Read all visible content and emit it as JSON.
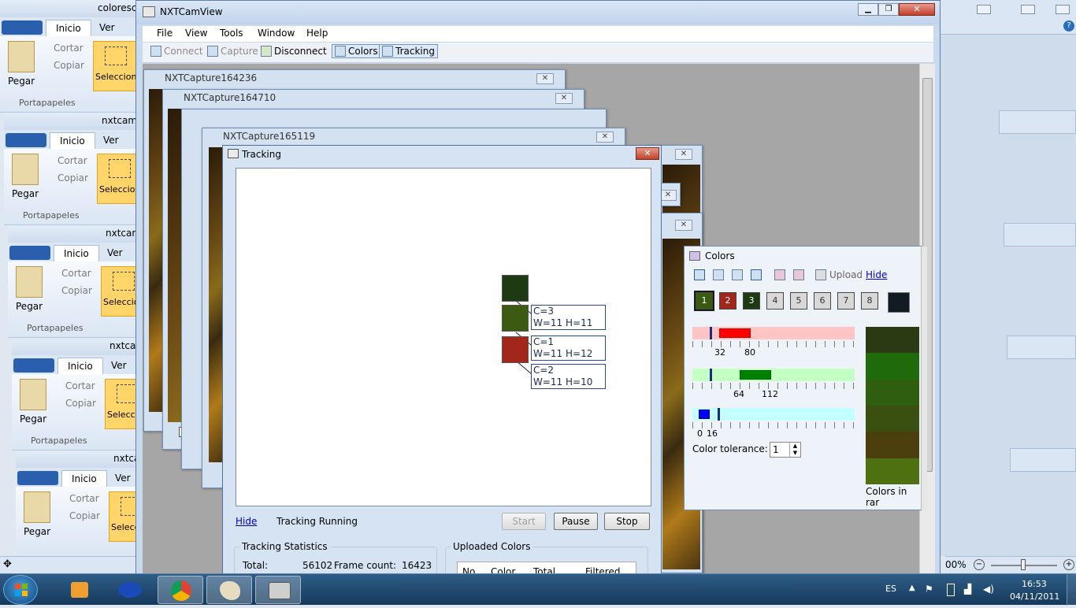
{
  "paint_windows": [
    {
      "title": "coloresch",
      "tab_home": "Inicio",
      "tab_view": "Ver",
      "paste": "Pegar",
      "cut": "Cortar",
      "copy": "Copiar",
      "select": "Seleccionar",
      "group": "Portapapeles"
    },
    {
      "title": "nxtcamf",
      "tab_home": "Inicio",
      "tab_view": "Ver",
      "paste": "Pegar",
      "cut": "Cortar",
      "copy": "Copiar",
      "select": "Seleccionar",
      "group": "Portapapeles"
    },
    {
      "title": "nxtcam",
      "tab_home": "Inicio",
      "tab_view": "Ver",
      "paste": "Pegar",
      "cut": "Cortar",
      "copy": "Copiar",
      "select": "Seleccionar",
      "group": "Portapapeles"
    },
    {
      "title": "nxtcar",
      "tab_home": "Inicio",
      "tab_view": "Ver",
      "paste": "Pegar",
      "cut": "Cortar",
      "copy": "Copiar",
      "select": "Seleccionar",
      "group": "Portapapeles"
    },
    {
      "title": "nxtca",
      "tab_home": "Inicio",
      "tab_view": "Ver",
      "paste": "Pegar",
      "cut": "Cortar",
      "copy": "Copiar",
      "select": "Seleccionar",
      "group": ""
    }
  ],
  "zoom_text": "00%",
  "main": {
    "title": "NXTCamView",
    "menu": [
      "File",
      "View",
      "Tools",
      "Window",
      "Help"
    ],
    "toolbar": {
      "connect": "Connect",
      "capture": "Capture",
      "disconnect": "Disconnect",
      "colors": "Colors",
      "tracking": "Tracking"
    }
  },
  "captures": [
    "NXTCapture164236",
    "NXTCapture164710",
    "NXTCapture165119"
  ],
  "capture_checkbox": "H",
  "tracking": {
    "title": "Tracking",
    "blobs": [
      {
        "color": "#1d3a12"
      },
      {
        "color": "#3c5a12",
        "line1": "C=3",
        "line2": "W=11 H=11"
      },
      {
        "color": "#a3261a",
        "line1": "C=1",
        "line2": "W=11 H=12"
      },
      {
        "line1": "C=2",
        "line2": "W=11 H=10"
      }
    ],
    "hide": "Hide",
    "status": "Tracking Running",
    "start": "Start",
    "pause": "Pause",
    "stop": "Stop",
    "stats_title": "Tracking Statistics",
    "total_label": "Total:",
    "total_value": "56102",
    "frame_label": "Frame count:",
    "frame_value": "16423",
    "uploaded_title": "Uploaded Colors",
    "columns": [
      "No.",
      "Color",
      "Total",
      "Filtered"
    ]
  },
  "colors_win": {
    "title": "Colors",
    "upload": "Upload",
    "hide": "Hide",
    "swatches": [
      {
        "n": "1",
        "c": "#3a5a10"
      },
      {
        "n": "2",
        "c": "#a3261a"
      },
      {
        "n": "3",
        "c": "#1d3a12"
      },
      {
        "n": "4",
        "c": "#d8d8d8"
      },
      {
        "n": "5",
        "c": "#d8d8d8"
      },
      {
        "n": "6",
        "c": "#d8d8d8"
      },
      {
        "n": "7",
        "c": "#d8d8d8"
      },
      {
        "n": "8",
        "c": "#d8d8d8"
      }
    ],
    "selected_color": "#121a22",
    "red": {
      "min": "32",
      "max": "80"
    },
    "green": {
      "min": "64",
      "max": "112"
    },
    "blue": {
      "min": "0",
      "max": "16"
    },
    "tolerance_label": "Color tolerance:",
    "tolerance_value": "1",
    "range_label": "Colors in rar",
    "range_colors": [
      "#2a3a12",
      "#1f6a0a",
      "#2e5e0e",
      "#3a5010",
      "#4a3e0c",
      "#4e7010"
    ]
  },
  "tray": {
    "lang": "ES",
    "time": "16:53",
    "date": "04/11/2011"
  }
}
